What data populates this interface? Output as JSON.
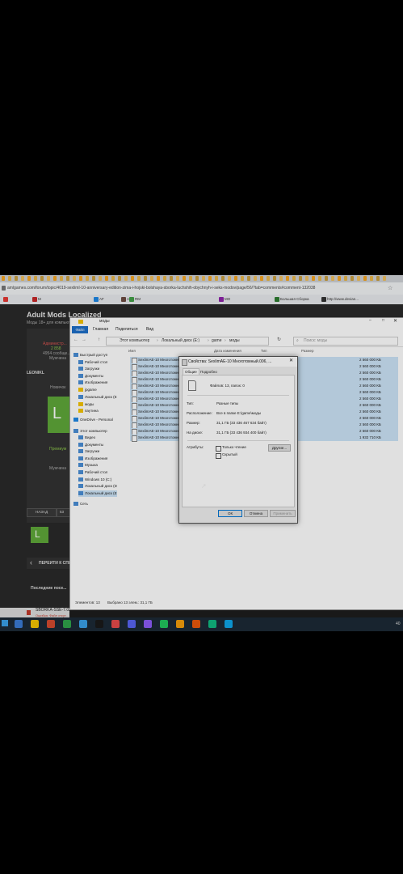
{
  "browser": {
    "url": "amlgames.com/forum/topic/4019-sexlimI-10-anniversary-edition-zima-i-hojski-bolshaya-sborka-luchshih-obychnyh-i-seks-modov/page/56/?tab=comments#comment-132038",
    "bookmarks": [
      "M",
      "AF",
      "AP",
      "RM",
      "MO",
      "Большая Сборка",
      "http://www.devian..."
    ]
  },
  "site": {
    "title": "Adult Mods Localized",
    "subtitle": "Моды 18+ для компьют...",
    "user_name": "LEONIKL",
    "user_rank": "Новичок",
    "premium_label": "Премиум",
    "gender": "Мужчина",
    "admin_name": "Администр...",
    "admin_points": "2 858",
    "admin_msgs": "4954 сообще...",
    "admin_gender": "Мужчина",
    "avatar_letter": "L",
    "pager_back": "НАЗАД",
    "pager_page": "53",
    "goto_label": "ПЕРЕЙТИ К СПИ...",
    "recent_label": "Последние посе..."
  },
  "explorer": {
    "window_title": "моды",
    "ribbon_tabs": [
      "Файл",
      "Главная",
      "Поделиться",
      "Вид"
    ],
    "path": [
      "Этот компьютер",
      "Локальный диск (E:)",
      "game",
      "моды"
    ],
    "search_placeholder": "Поиск: моды",
    "columns": [
      "Имя",
      "Дата изменения",
      "Тип",
      "Размер"
    ],
    "nav_items": [
      {
        "label": "Быстрый доступ",
        "icon": "star-icon"
      },
      {
        "label": "Рабочий стол",
        "icon": "desktop-icon"
      },
      {
        "label": "Загрузки",
        "icon": "download-icon"
      },
      {
        "label": "Документы",
        "icon": "documents-icon"
      },
      {
        "label": "Изображения",
        "icon": "pictures-icon"
      },
      {
        "label": "jpgame",
        "icon": "folder-icon"
      },
      {
        "label": "Локальный диск (E",
        "icon": "drive-icon"
      },
      {
        "label": "моды",
        "icon": "folder-icon"
      },
      {
        "label": "паутина",
        "icon": "folder-icon"
      },
      {
        "label": "OneDrive - Personal",
        "icon": "cloud-icon"
      },
      {
        "label": "Этот компьютер",
        "icon": "computer-icon"
      },
      {
        "label": "Видео",
        "icon": "video-icon"
      },
      {
        "label": "Документы",
        "icon": "documents-icon"
      },
      {
        "label": "Загрузки",
        "icon": "download-icon"
      },
      {
        "label": "Изображения",
        "icon": "pictures-icon"
      },
      {
        "label": "Музыка",
        "icon": "music-icon"
      },
      {
        "label": "Рабочий стол",
        "icon": "desktop-icon"
      },
      {
        "label": "Windows 10 (C:)",
        "icon": "drive-icon"
      },
      {
        "label": "Локальный диск (D",
        "icon": "drive-icon"
      },
      {
        "label": "Локальный диск (E",
        "icon": "drive-icon"
      },
      {
        "label": "Сеть",
        "icon": "network-icon"
      }
    ],
    "files": [
      {
        "name": "SexlimAE-10 Многотомный...",
        "size": "2 560 000 КБ"
      },
      {
        "name": "SexlimAE-10 Многотомный...",
        "size": "2 560 000 КБ"
      },
      {
        "name": "SexlimAE-10 Многотомный...",
        "size": "2 560 000 КБ"
      },
      {
        "name": "SexlimAE-10 Многотомный...",
        "size": "2 560 000 КБ"
      },
      {
        "name": "SexlimAE-10 Многотомный...",
        "size": "2 560 000 КБ"
      },
      {
        "name": "SexlimAE-10 Многотомный...",
        "size": "2 560 000 КБ"
      },
      {
        "name": "SexlimAE-10 Многотомный...",
        "size": "2 560 000 КБ"
      },
      {
        "name": "SexlimAE-10 Многотомный...",
        "size": "2 560 000 КБ"
      },
      {
        "name": "SexlimAE-10 Многотомный...",
        "size": "2 560 000 КБ"
      },
      {
        "name": "SexlimAE-10 Многотомный...",
        "size": "2 560 000 КБ"
      },
      {
        "name": "SexlimAE-10 Многотомный...",
        "size": "2 560 000 КБ"
      },
      {
        "name": "SexlimAE-10 Многотомный...",
        "size": "2 560 000 КБ"
      },
      {
        "name": "SexlimAE-10 Многотомный...",
        "size": "1 932 710 КБ"
      }
    ],
    "status_items": "Элементов: 13",
    "status_selected": "Выбрано 13 элем.: 31,1 ГБ"
  },
  "dialog": {
    "title": "Свойства: SexlimAE-10 Многотомный.006, ...",
    "tabs": [
      "Общие",
      "Подробно"
    ],
    "summary": "Файлов: 13, папок: 0",
    "rows": [
      {
        "label": "Тип:",
        "value": "Разные типы"
      },
      {
        "label": "Расположение:",
        "value": "Все в папке E:\\game\\моды"
      },
      {
        "label": "Размер:",
        "value": "31,1 ГБ (33 436 467 634 байт)"
      },
      {
        "label": "На диске:",
        "value": "31,1 ГБ (33 436 934 400 байт)"
      }
    ],
    "attributes_label": "Атрибуты:",
    "readonly_label": "Только чтение",
    "hidden_label": "Скрытый",
    "other_button": "Другие...",
    "ok": "ОК",
    "cancel": "Отмена",
    "apply": "Применить"
  },
  "taskbar": {
    "download_name": "SBORKA-SSE-7.0Z...",
    "download_error": "Ошибка: Файл отсут...",
    "time_label": "40",
    "icon_colors": [
      "#3b7bd4",
      "#f5c400",
      "#d44a2f",
      "#2fa34a",
      "#3aa0e8",
      "#1a1a1a",
      "#e54b4b",
      "#5865f2",
      "#8b5cf6",
      "#22c55e",
      "#f59e0b",
      "#ea580c",
      "#10b981",
      "#0ea5e9"
    ]
  }
}
